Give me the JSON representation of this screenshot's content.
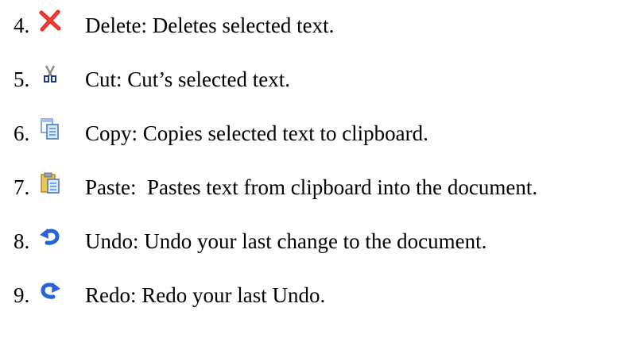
{
  "items": [
    {
      "number": "4.",
      "icon": "delete-icon",
      "text": "Delete: Deletes selected text."
    },
    {
      "number": "5.",
      "icon": "cut-icon",
      "text": "Cut: Cut’s selected text."
    },
    {
      "number": "6.",
      "icon": "copy-icon",
      "text": "Copy: Copies selected text to clipboard."
    },
    {
      "number": "7.",
      "icon": "paste-icon",
      "text": "Paste:  Pastes text from clipboard into the document."
    },
    {
      "number": "8.",
      "icon": "undo-icon",
      "text": "Undo: Undo your last change to the document."
    },
    {
      "number": "9.",
      "icon": "redo-icon",
      "text": "Redo: Redo your last Undo."
    }
  ],
  "colors": {
    "delete": "#e8231b",
    "cut": "#1b3a8a",
    "copy": "#5b8fd6",
    "paste": "#d9b43a",
    "undo": "#2a63d8",
    "redo": "#2a63d8"
  }
}
